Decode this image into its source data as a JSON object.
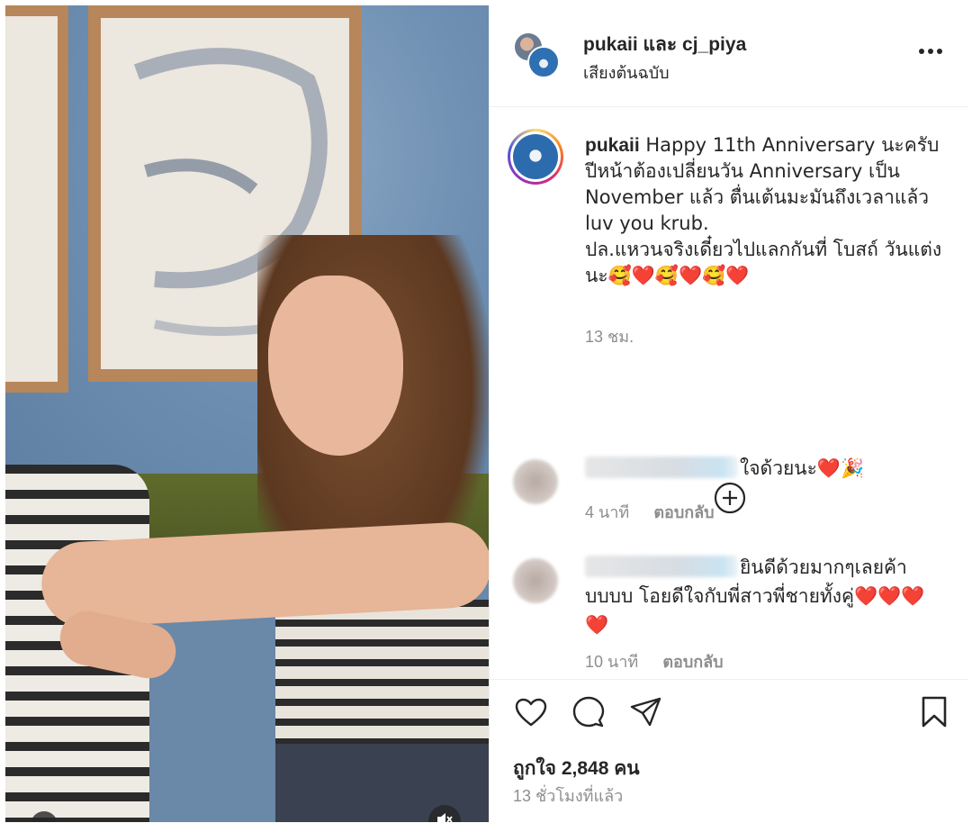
{
  "header": {
    "names": "pukaii และ cj_piya",
    "audio_label": "เสียงต้นฉบับ",
    "more_icon": "more-horizontal-icon"
  },
  "caption": {
    "username": "pukaii",
    "text": " Happy 11th Anniversary นะครับ ปีหน้าต้องเปลี่ยนวัน Anniversary เป็น November แล้ว ตื่นเต้นมะมันถึงเวลาแล้ว luv you krub.\nปล.แหวนจริงเดี๋ยวไปแลกกันที่ โบสถ์ วันแต่งนะ🥰❤️🥰❤️🥰❤️",
    "time": "13 ชม."
  },
  "load_more_icon": "plus-circle-icon",
  "comments": [
    {
      "text": "ใจด้วยนะ❤️🎉",
      "time": "4 นาที",
      "reply_label": "ตอบกลับ"
    },
    {
      "text": "ยินดีด้วยมากๆเลยค้าบบบบ โอยดีใจกับพี่สาวพี่ชายทั้งคู่❤️❤️❤️❤️",
      "time": "10 นาที",
      "reply_label": "ตอบกลับ"
    }
  ],
  "actions": {
    "like_icon": "heart-icon",
    "comment_icon": "comment-icon",
    "share_icon": "send-icon",
    "save_icon": "bookmark-icon"
  },
  "likes_text": "ถูกใจ 2,848 คน",
  "posted_time": "13 ชั่วโมงที่แล้ว",
  "media": {
    "mute_icon": "speaker-muted-icon"
  },
  "colors": {
    "text": "#262626",
    "secondary": "#8e8e8e",
    "divider": "#efefef"
  }
}
